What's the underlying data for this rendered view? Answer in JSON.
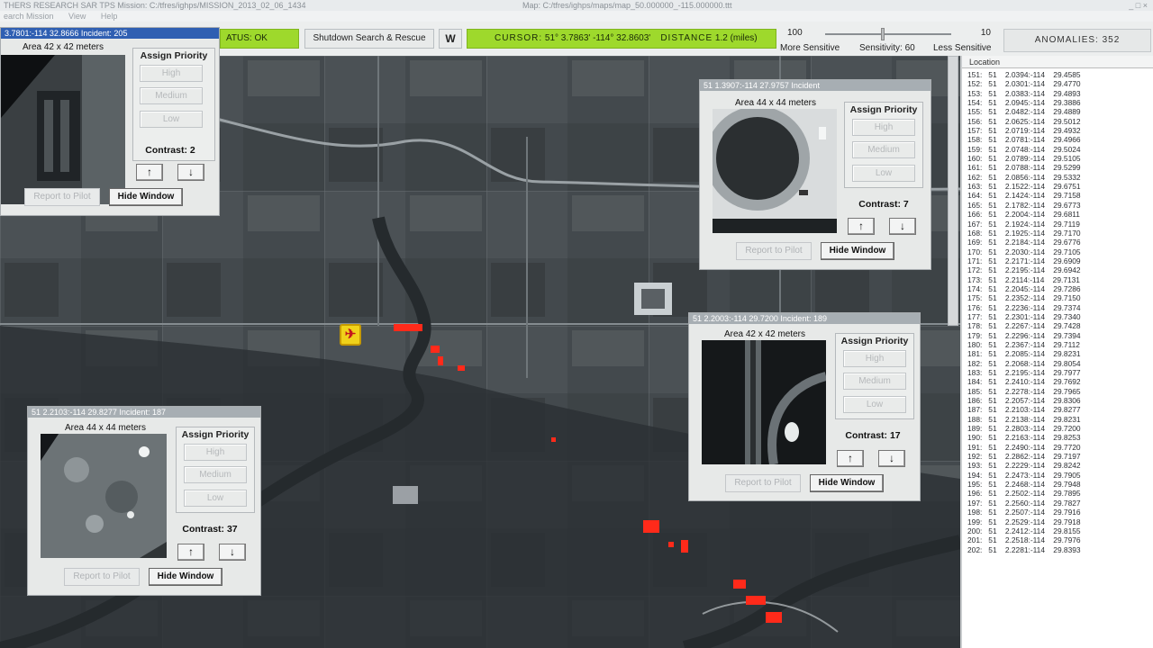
{
  "window": {
    "title": "THERS RESEARCH SAR TPS    Mission: C:/tfres/ighps/MISSION_2013_02_06_1434",
    "center_title": "Map: C:/tfres/ighps/maps/map_50.000000_-115.000000.ttt",
    "win_buttons": "_ □ ×"
  },
  "menu": [
    "earch Mission",
    "View",
    "Help"
  ],
  "toolbar": {
    "status": "ATUS: OK",
    "shutdown": "Shutdown Search & Rescue",
    "w_button": "W",
    "cursor_label": "CURSOR:",
    "cursor_value": "51° 3.7863'  -114° 32.8603'",
    "distance_label": "DISTANCE",
    "distance_value": "1.2 (miles)",
    "sens_min": "100",
    "sens_max": "10",
    "more_sensitive": "More Sensitive",
    "sensitivity": "Sensitivity: 60",
    "less_sensitive": "Less Sensitive",
    "anomalies": "ANOMALIES: 352",
    "sensitivity_value": 60
  },
  "location_header": "Location",
  "locations": [
    "151:   51    2.0394:-114    29.4585",
    "152:   51    2.0301:-114    29.4770",
    "153:   51    2.0383:-114    29.4893",
    "154:   51    2.0945:-114    29.3886",
    "155:   51    2.0482:-114    29.4889",
    "156:   51    2.0625:-114    29.5012",
    "157:   51    2.0719:-114    29.4932",
    "158:   51    2.0781:-114    29.4966",
    "159:   51    2.0748:-114    29.5024",
    "160:   51    2.0789:-114    29.5105",
    "161:   51    2.0788:-114    29.5299",
    "162:   51    2.0856:-114    29.5332",
    "163:   51    2.1522:-114    29.6751",
    "164:   51    2.1424:-114    29.7158",
    "165:   51    2.1782:-114    29.6773",
    "166:   51    2.2004:-114    29.6811",
    "167:   51    2.1924:-114    29.7119",
    "168:   51    2.1925:-114    29.7170",
    "169:   51    2.2184:-114    29.6776",
    "170:   51    2.2030:-114    29.7105",
    "171:   51    2.2171:-114    29.6909",
    "172:   51    2.2195:-114    29.6942",
    "173:   51    2.2114:-114    29.7131",
    "174:   51    2.2045:-114    29.7286",
    "175:   51    2.2352:-114    29.7150",
    "176:   51    2.2236:-114    29.7374",
    "177:   51    2.2301:-114    29.7340",
    "178:   51    2.2267:-114    29.7428",
    "179:   51    2.2296:-114    29.7394",
    "180:   51    2.2367:-114    29.7112",
    "181:   51    2.2085:-114    29.8231",
    "182:   51    2.2068:-114    29.8054",
    "183:   51    2.2195:-114    29.7977",
    "184:   51    2.2410:-114    29.7692",
    "185:   51    2.2278:-114    29.7965",
    "186:   51    2.2057:-114    29.8306",
    "187:   51    2.2103:-114    29.8277",
    "188:   51    2.2138:-114    29.8231",
    "189:   51    2.2803:-114    29.7200",
    "190:   51    2.2163:-114    29.8253",
    "191:   51    2.2490:-114    29.7720",
    "192:   51    2.2862:-114    29.7197",
    "193:   51    2.2229:-114    29.8242",
    "194:   51    2.2473:-114    29.7905",
    "195:   51    2.2468:-114    29.7948",
    "196:   51    2.2502:-114    29.7895",
    "197:   51    2.2560:-114    29.7827",
    "198:   51    2.2507:-114    29.7916",
    "199:   51    2.2529:-114    29.7918",
    "200:   51    2.2412:-114    29.8155",
    "201:   51    2.2518:-114    29.7976",
    "202:   51    2.2281:-114    29.8393"
  ],
  "panels": {
    "p1": {
      "title": "3.7801:-114   32.8666 Incident: 205",
      "area": "Area 42 x 42 meters",
      "contrast": "Contrast: 2"
    },
    "p2": {
      "title": "51    1.3907:-114   27.9757 Incident",
      "area": "Area 44 x 44 meters",
      "contrast": "Contrast: 7"
    },
    "p3": {
      "title": "51    2.2003:-114   29.7200 Incident: 189",
      "area": "Area 42 x 42 meters",
      "contrast": "Contrast: 17"
    },
    "p4": {
      "title": "51    2.2103:-114   29.8277 Incident: 187",
      "area": "Area 44 x 44 meters",
      "contrast": "Contrast: 37"
    }
  },
  "labels": {
    "assign_priority": "Assign Priority",
    "high": "High",
    "medium": "Medium",
    "low": "Low",
    "up": "↑",
    "down": "↓",
    "report": "Report to Pilot",
    "hide": "Hide Window"
  },
  "colors": {
    "status_green": "#9ed92c",
    "anomaly_red": "#ff2a1a",
    "active_title": "#2f5fb2"
  },
  "icons": {
    "plane_marker": "aircraft-position-icon"
  }
}
